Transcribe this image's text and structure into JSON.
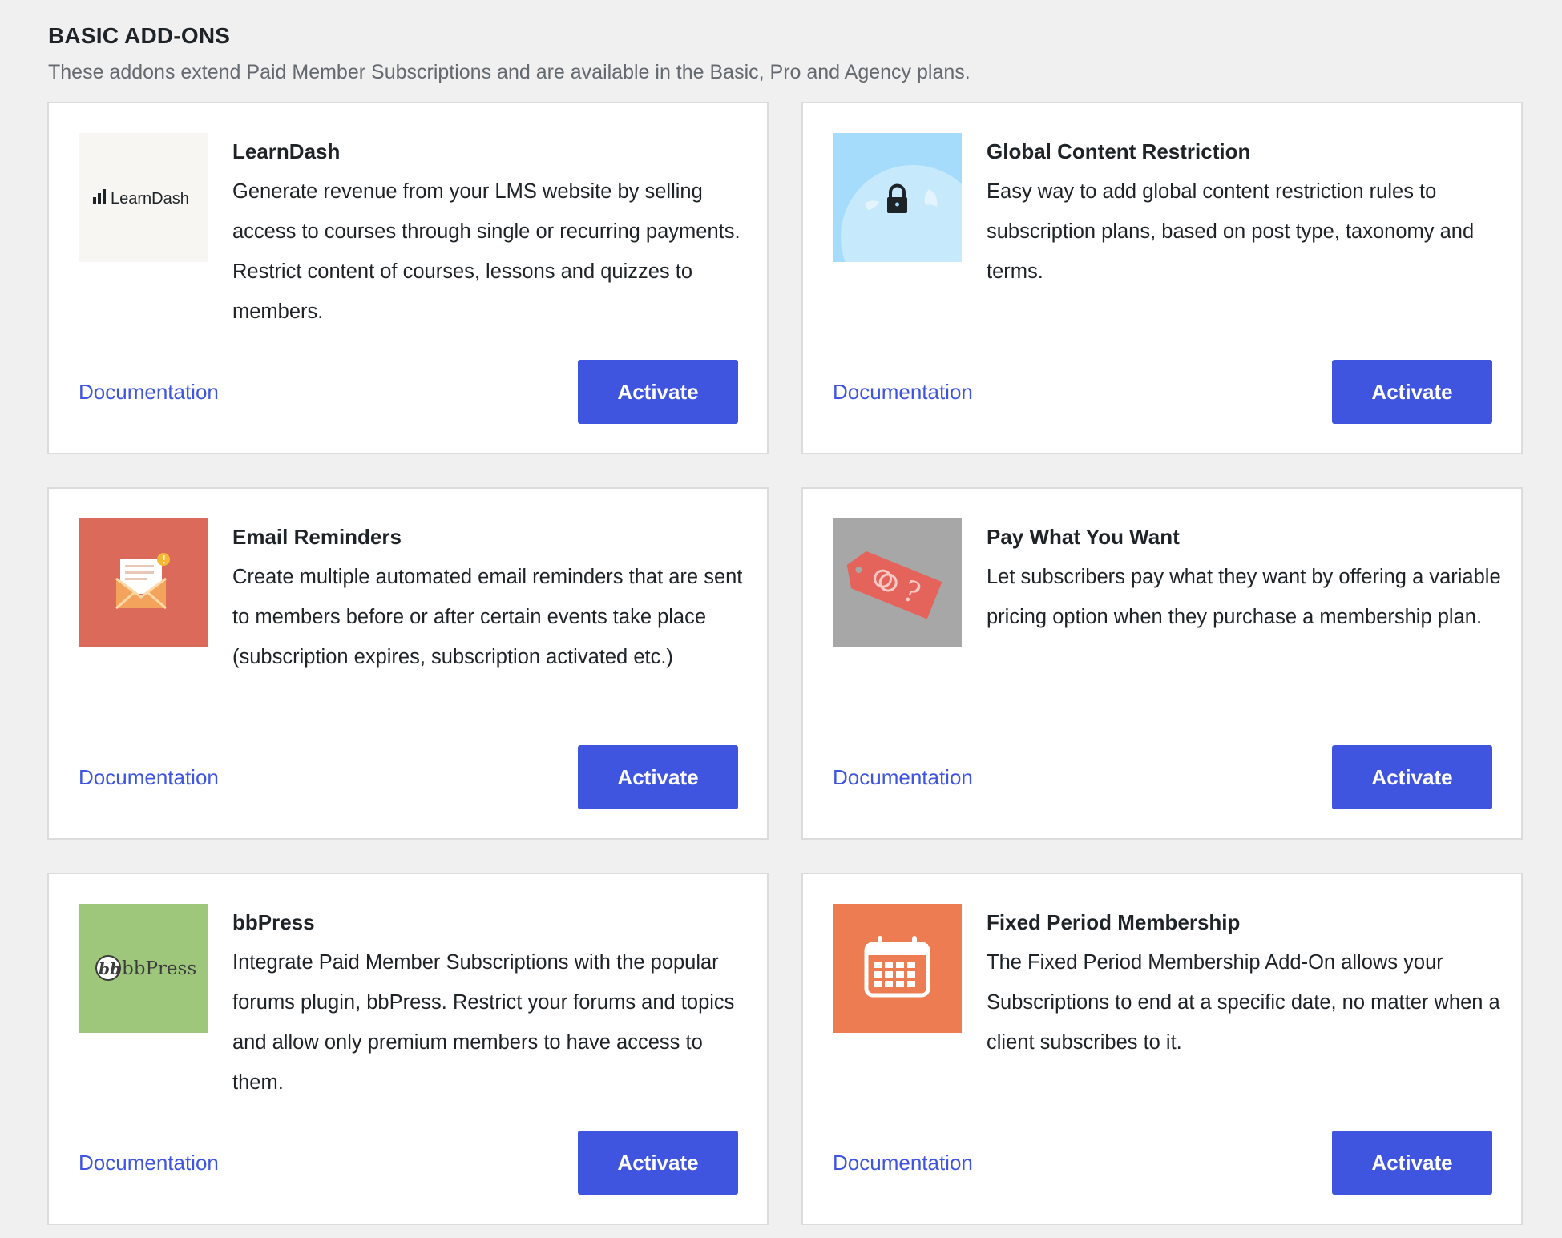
{
  "section": {
    "title": "BASIC ADD-ONS",
    "description": "These addons extend Paid Member Subscriptions and are available in the Basic, Pro and Agency plans."
  },
  "colors": {
    "accent": "#3f55df",
    "page_background": "#f0f0f1",
    "card_border": "#dcdcde"
  },
  "addons": [
    {
      "title": "LearnDash",
      "description": "Generate revenue from your LMS website by selling access to courses through single or recurring payments. Restrict content of courses, lessons and quizzes to members.",
      "icon": "learndash-logo-icon",
      "icon_text": "LearnDash",
      "documentation_label": "Documentation",
      "action_label": "Activate"
    },
    {
      "title": "Global Content Restriction",
      "description": "Easy way to add global content restriction rules to subscription plans, based on post type, taxonomy and terms.",
      "icon": "globe-lock-icon",
      "documentation_label": "Documentation",
      "action_label": "Activate"
    },
    {
      "title": "Email Reminders",
      "description": "Create multiple automated email reminders that are sent to members before or after certain events take place (subscription expires, subscription activated etc.)",
      "icon": "envelope-alert-icon",
      "documentation_label": "Documentation",
      "action_label": "Activate"
    },
    {
      "title": "Pay What You Want",
      "description": "Let subscribers pay what they want by offering a variable pricing option when they purchase a membership plan.",
      "icon": "price-tag-icon",
      "documentation_label": "Documentation",
      "action_label": "Activate"
    },
    {
      "title": "bbPress",
      "description": "Integrate Paid Member Subscriptions with the popular forums plugin, bbPress. Restrict your forums and topics and allow only premium members to have access to them.",
      "icon": "bbpress-logo-icon",
      "icon_text": "bbPress",
      "documentation_label": "Documentation",
      "action_label": "Activate"
    },
    {
      "title": "Fixed Period Membership",
      "description": "The Fixed Period Membership Add-On allows your Subscriptions to end at a specific date, no matter when a client subscribes to it.",
      "icon": "calendar-icon",
      "documentation_label": "Documentation",
      "action_label": "Activate"
    }
  ]
}
